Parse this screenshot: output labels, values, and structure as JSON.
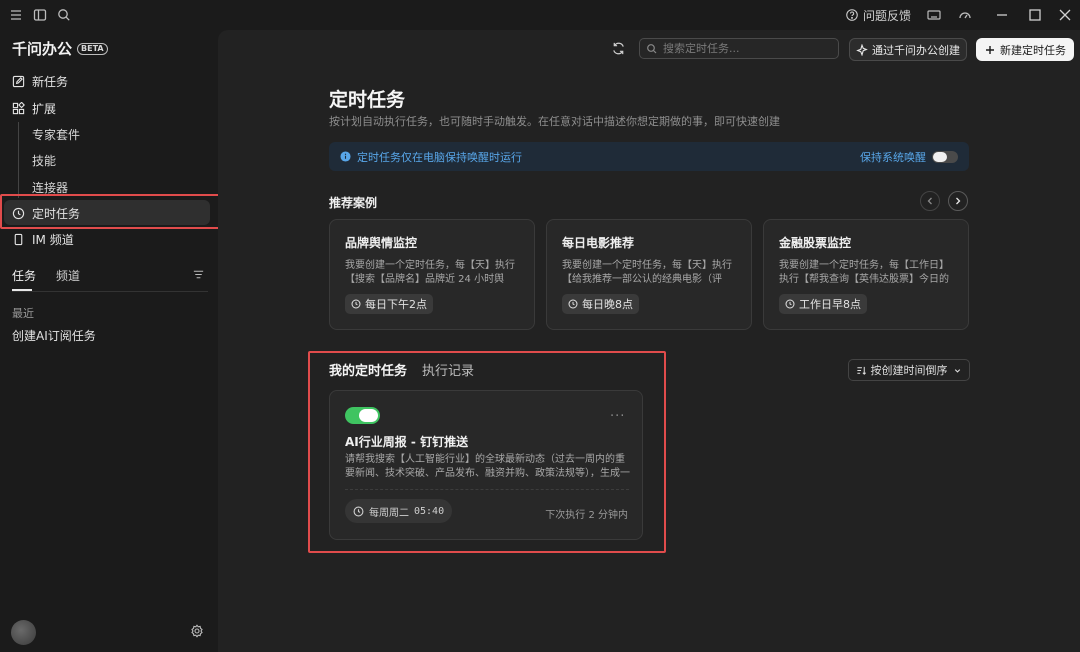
{
  "titlebar": {
    "feedback_label": "问题反馈"
  },
  "sidebar": {
    "brand": "千问办公",
    "beta": "BETA",
    "nav": {
      "new_task": "新任务",
      "extend": "扩展",
      "expert_kit": "专家套件",
      "skills": "技能",
      "connectors": "连接器",
      "scheduled": "定时任务",
      "im_channel": "IM 频道"
    },
    "tabs": [
      "任务",
      "频道"
    ],
    "recent_label": "最近",
    "recent_items": [
      "创建AI订阅任务"
    ]
  },
  "header": {
    "search_placeholder": "搜索定时任务...",
    "create_via_label": "通过千问办公创建",
    "new_task_label": "新建定时任务"
  },
  "main": {
    "title": "定时任务",
    "subtitle": "按计划自动执行任务，也可随时手动触发。在任意对话中描述你想定期做的事，即可快速创建",
    "banner": {
      "text": "定时任务仅在电脑保持唤醒时运行",
      "toggle_label": "保持系统唤醒",
      "toggle_on": false
    },
    "recommended_title": "推荐案例",
    "recommended": [
      {
        "title": "品牌舆情监控",
        "desc": "我要创建一个定时任务，每【天】执行【搜索【品牌名】品牌近 24 小时舆情...",
        "schedule": "每日下午2点"
      },
      {
        "title": "每日电影推荐",
        "desc": "我要创建一个定时任务，每【天】执行【给我推荐一部公认的经典电影（评分...",
        "schedule": "每日晚8点"
      },
      {
        "title": "金融股票监控",
        "desc": "我要创建一个定时任务，每【工作日】执行【帮我查询【英伟达股票】今日的走...",
        "schedule": "工作日早8点"
      }
    ],
    "tabs": [
      "我的定时任务",
      "执行记录"
    ],
    "sort_label": "按创建时间倒序",
    "task": {
      "enabled": true,
      "title": "AI行业周报 - 钉钉推送",
      "desc": "请帮我搜索【人工智能行业】的全球最新动态（过去一周内的重要新闻、技术突破、产品发布、融资并购、政策法规等），生成一份结...",
      "schedule_prefix": "每周周二",
      "schedule_time": "05:40",
      "next_run": "下次执行 2 分钟内"
    }
  },
  "colors": {
    "accent_green": "#3fc461",
    "info_blue": "#58a6e8",
    "highlight_red": "#e14c4c"
  }
}
